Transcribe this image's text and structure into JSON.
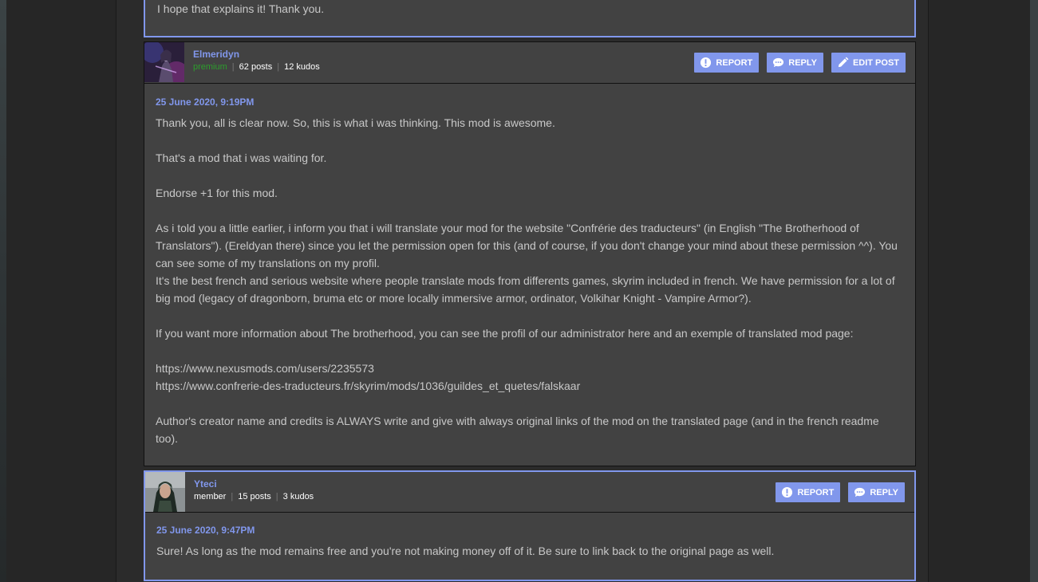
{
  "previous_post": {
    "text": "I hope that explains it! Thank you."
  },
  "posts": [
    {
      "author": "Elmeridyn",
      "rank": "premium",
      "posts": "62 posts",
      "kudos": "12 kudos",
      "date": "25 June 2020, 9:19PM",
      "actions": {
        "report": "REPORT",
        "reply": "REPLY",
        "edit": "EDIT POST"
      },
      "paragraphs": [
        "Thank you, all is clear now. So, this is what i was thinking. This mod is awesome.",
        "That's a mod that i was waiting for.",
        "Endorse +1 for this mod.",
        "As i told you a little earlier, i inform you that i will translate your mod for the website \"Confrérie des traducteurs\" (in English \"The Brotherhood of Translators\"). (Ereldyan there) since you let the permission open for this (and of course, if you don't change your mind about these permission ^^). You can see some of my translations on my profil.\nIt's the best french and serious website where people translate mods from differents games, skyrim included in french. We have permission for a lot of big mod (legacy of dragonborn, bruma etc or more locally immersive armor, ordinator, Volkihar Knight - Vampire Armor?).",
        "If you want more information about The brotherhood, you can see the profil of our administrator here and an exemple of translated mod page:",
        "https://www.nexusmods.com/users/2235573\nhttps://www.confrerie-des-traducteurs.fr/skyrim/mods/1036/guildes_et_quetes/falskaar",
        "Author's creator name and credits is ALWAYS write and give with always original links of the mod on the translated page (and in the french readme too)."
      ]
    },
    {
      "author": "Yteci",
      "rank": "member",
      "posts": "15 posts",
      "kudos": "3 kudos",
      "date": "25 June 2020, 9:47PM",
      "actions": {
        "report": "REPORT",
        "reply": "REPLY"
      },
      "paragraphs": [
        "Sure! As long as the mod remains free and you're not making money off of it. Be sure to link back to the original page as well."
      ]
    }
  ],
  "icons": {
    "report": "alert-icon",
    "reply": "speech-bubble-icon",
    "edit": "pencil-icon"
  },
  "colors": {
    "accent": "#8197ec",
    "premium": "#2c9e2c",
    "post_bg": "#424242",
    "page_bg": "#2b2b2b"
  }
}
